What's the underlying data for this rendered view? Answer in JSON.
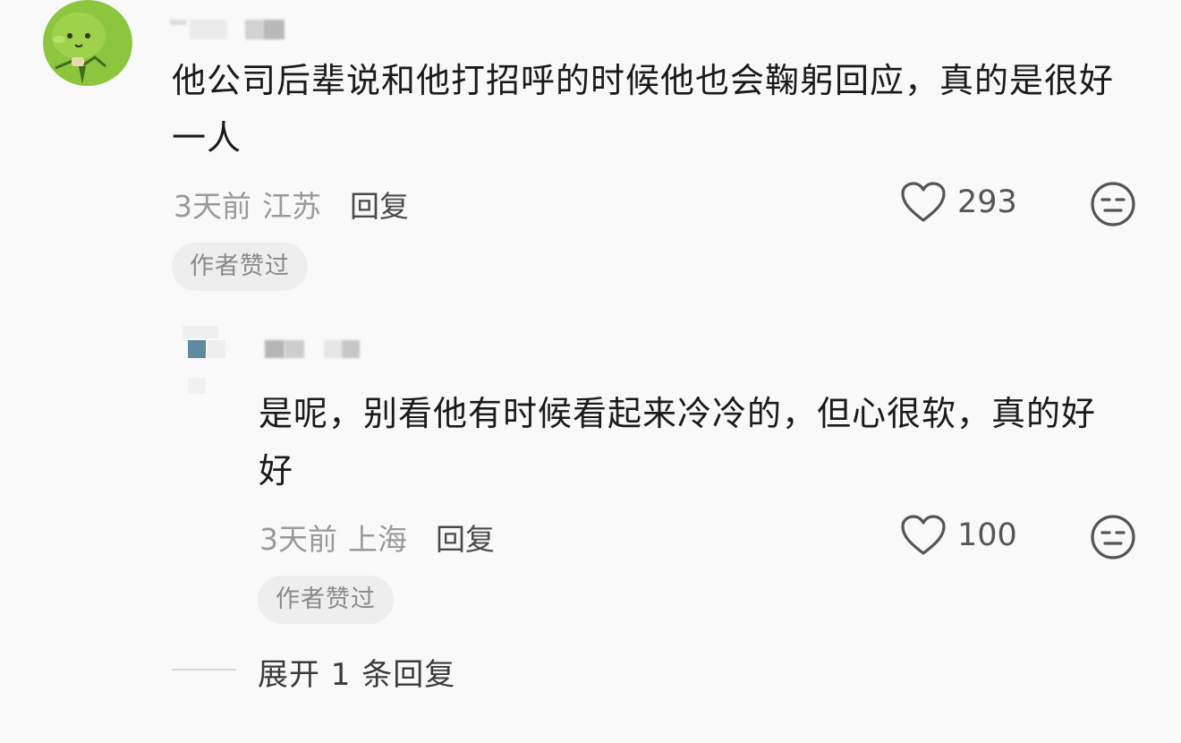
{
  "comments": [
    {
      "text": "他公司后辈说和他打招呼的时候他也会鞠躬回应，真的是很好一人",
      "time": "3天前",
      "location": "江苏",
      "reply_label": "回复",
      "likes": "293",
      "badge": "作者赞过"
    },
    {
      "text": "是呢，别看他有时候看起来冷冷的，但心很软，真的好好",
      "time": "3天前",
      "location": "上海",
      "reply_label": "回复",
      "likes": "100",
      "badge": "作者赞过"
    }
  ],
  "expand_label": "展开 1 条回复",
  "icons": {
    "like": "heart-outline-icon",
    "dislike": "neutral-face-icon"
  },
  "colors": {
    "background": "#f9f9f9",
    "avatar_green": "#8cc63f",
    "meta_gray": "#9a9a9a",
    "badge_bg": "#eeeeee"
  }
}
